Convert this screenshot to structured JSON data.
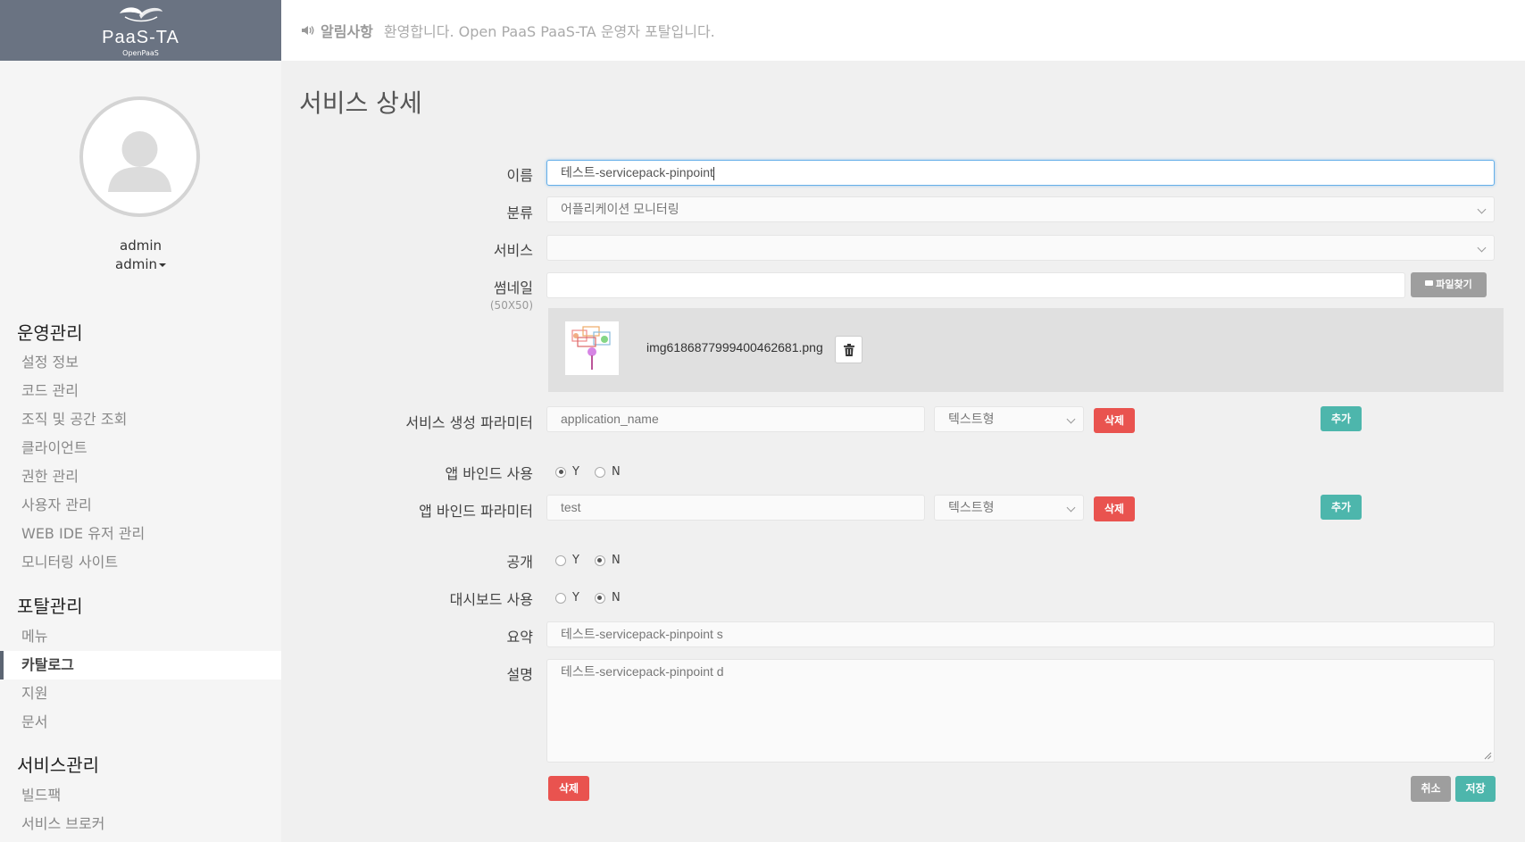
{
  "brand": {
    "title": "PaaS-TA",
    "subtitle": "OpenPaaS"
  },
  "notice": {
    "label": "알림사항",
    "text": "환영합니다. Open PaaS PaaS-TA 운영자 포탈입니다."
  },
  "user": {
    "name": "admin",
    "role": "admin"
  },
  "nav": {
    "sections": [
      {
        "title": "운영관리",
        "items": [
          "설정 정보",
          "코드 관리",
          "조직 및 공간 조회",
          "클라이언트",
          "권한 관리",
          "사용자 관리",
          "WEB IDE 유저 관리",
          "모니터링 사이트"
        ]
      },
      {
        "title": "포탈관리",
        "items": [
          "메뉴",
          "카탈로그",
          "지원",
          "문서"
        ]
      },
      {
        "title": "서비스관리",
        "items": [
          "빌드팩",
          "서비스 브로커"
        ]
      }
    ],
    "active": "카탈로그"
  },
  "page": {
    "title": "서비스 상세"
  },
  "form": {
    "name": {
      "label": "이름",
      "value": "테스트-servicepack-pinpoint"
    },
    "category": {
      "label": "분류",
      "value": "어플리케이션 모니터링"
    },
    "service": {
      "label": "서비스",
      "value": ""
    },
    "thumbnail": {
      "label": "썸네일",
      "hint": "(50X50)",
      "value": "",
      "find_button": "파일찾기",
      "file_name": "img6186877999400462681.png"
    },
    "create_params": {
      "label": "서비스 생성 파라미터",
      "value": "application_name",
      "type": "텍스트형",
      "delete_button": "삭제",
      "add_button": "추가"
    },
    "app_bind": {
      "label": "앱 바인드 사용",
      "options": [
        "Y",
        "N"
      ],
      "selected": "Y"
    },
    "bind_params": {
      "label": "앱 바인드 파라미터",
      "value": "test",
      "type": "텍스트형",
      "delete_button": "삭제",
      "add_button": "추가"
    },
    "public": {
      "label": "공개",
      "options": [
        "Y",
        "N"
      ],
      "selected": "N"
    },
    "dashboard": {
      "label": "대시보드 사용",
      "options": [
        "Y",
        "N"
      ],
      "selected": "N"
    },
    "summary": {
      "label": "요약",
      "value": "테스트-servicepack-pinpoint s"
    },
    "description": {
      "label": "설명",
      "value": "테스트-servicepack-pinpoint d"
    }
  },
  "actions": {
    "delete": "삭제",
    "cancel": "취소",
    "save": "저장"
  },
  "colors": {
    "sidebar_header": "#6a7382",
    "danger": "#e9534f",
    "primary": "#4db6ac",
    "neutral": "#9e9e9e"
  }
}
